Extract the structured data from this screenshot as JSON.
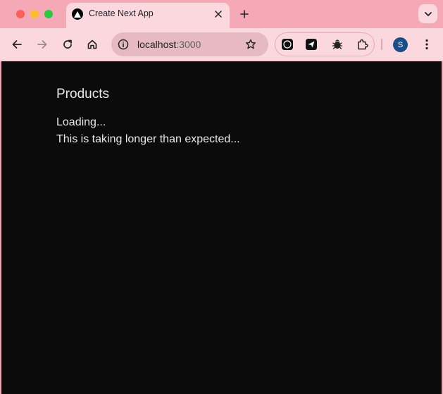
{
  "tab": {
    "title": "Create Next App",
    "favicon": "nextjs-triangle-icon"
  },
  "address_bar": {
    "host": "localhost",
    "port": ":3000"
  },
  "profile": {
    "initial": "S"
  },
  "page": {
    "heading": "Products",
    "loading": "Loading...",
    "slow_message": "This is taking longer than expected..."
  },
  "colors": {
    "chrome": "#f5a8b5",
    "toolbar": "#fbd8de",
    "page_bg": "#0b0b0c",
    "page_text": "#e9e9e9",
    "avatar": "#1c4f8a"
  }
}
